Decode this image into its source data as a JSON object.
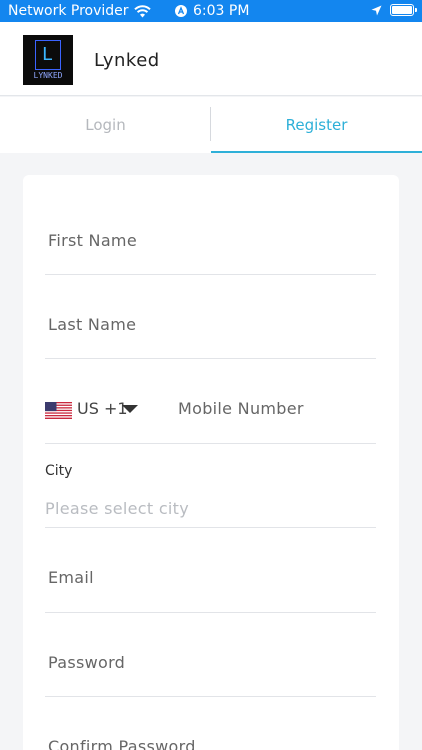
{
  "status_bar": {
    "carrier": "Network Provider",
    "time": "6:03 PM"
  },
  "header": {
    "logo_letter": "L",
    "logo_word": "LYNKED",
    "title": "Lynked"
  },
  "tabs": [
    {
      "label": "Login",
      "selected": false
    },
    {
      "label": "Register",
      "selected": true
    }
  ],
  "form": {
    "first_name_placeholder": "First Name",
    "last_name_placeholder": "Last Name",
    "country_code": "US +1",
    "mobile_placeholder": "Mobile Number",
    "city_label": "City",
    "city_placeholder": "Please select city",
    "email_placeholder": "Email",
    "password_placeholder": "Password",
    "confirm_password_placeholder": "Confirm Password"
  },
  "colors": {
    "status_bar": "#1386ef",
    "accent": "#2eb0d8"
  },
  "icons": [
    "wifi-icon",
    "location-a-icon",
    "location-arrow-icon",
    "battery-icon",
    "us-flag-icon",
    "caret-down-icon"
  ]
}
